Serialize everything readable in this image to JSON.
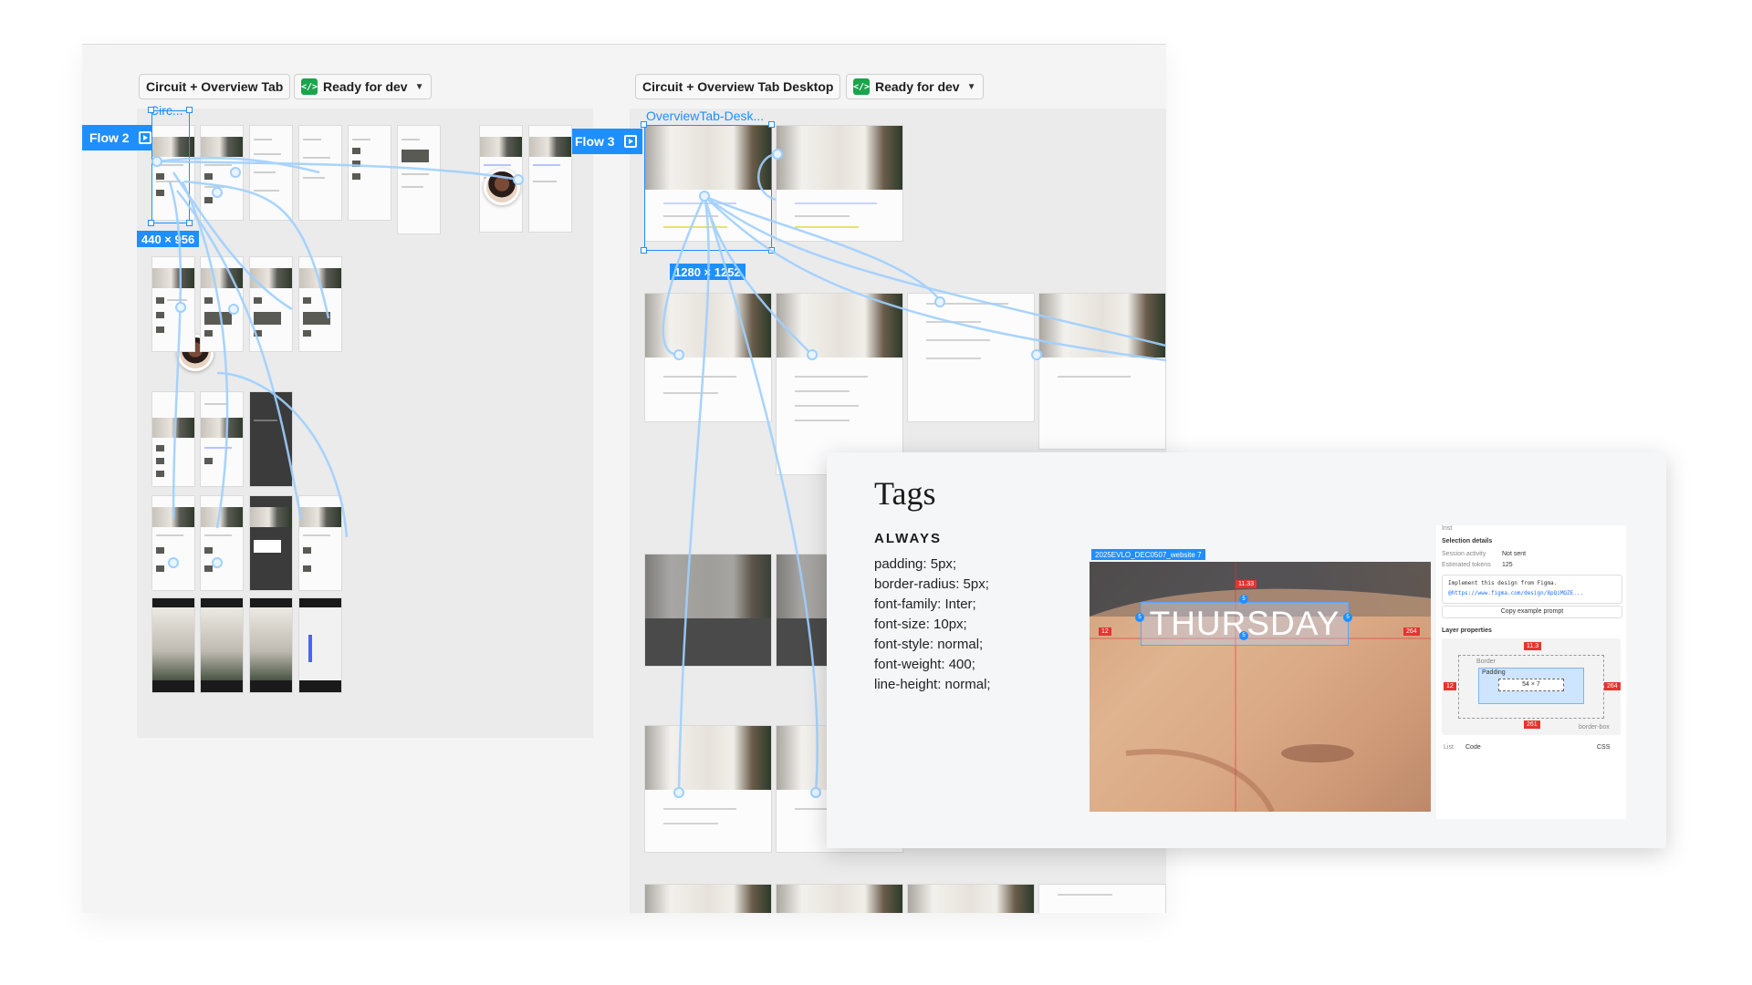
{
  "left_section": {
    "title": "Circuit + Overview Tab",
    "status": "Ready for dev",
    "frame_label": "Circ...",
    "flow_tag": "Flow 2",
    "dimension": "440 × 956"
  },
  "right_section": {
    "title": "Circuit + Overview Tab Desktop",
    "status": "Ready for dev",
    "frame_label": "OverviewTab-Desk...",
    "flow_tag": "Flow 3",
    "dimension": "1280 × 1252"
  },
  "inspector": {
    "title": "Tags",
    "subheading": "ALWAYS",
    "properties": [
      "padding: 5px;",
      "border-radius: 5px;",
      "font-family: Inter;",
      "font-size: 10px;",
      "font-style: normal;",
      "font-weight: 400;",
      "line-height: normal;"
    ],
    "canvas": {
      "layer_tag": "2025EVLO_DEC0507_website 7",
      "text": "THURSDAY",
      "measure_top": "11.33",
      "measure_left": "12",
      "measure_right": "264",
      "padding_value": "5"
    },
    "panel": {
      "header": "Inst",
      "selection_details": "Selection details",
      "session_activity_label": "Session activity",
      "session_activity_value": "Not sent",
      "estimated_tokens_label": "Estimated tokens",
      "estimated_tokens_value": "125",
      "prompt_line1": "Implement this design from Figma.",
      "prompt_line2": "@https://www.figma.com/design/8pQiMQZE...",
      "copy_button": "Copy example prompt",
      "layer_properties": "Layer properties",
      "box_top": "11.3",
      "box_left": "12",
      "box_right": "264",
      "box_bottom": "261",
      "border_label": "Border",
      "padding_label": "Padding",
      "content_size": "54 × 7",
      "box_model": "border-box",
      "tab_list": "List",
      "tab_code": "Code",
      "lang": "CSS"
    }
  },
  "colors": {
    "accent": "#1f8fff",
    "ready": "#19a54b",
    "redline": "#e5342f"
  }
}
